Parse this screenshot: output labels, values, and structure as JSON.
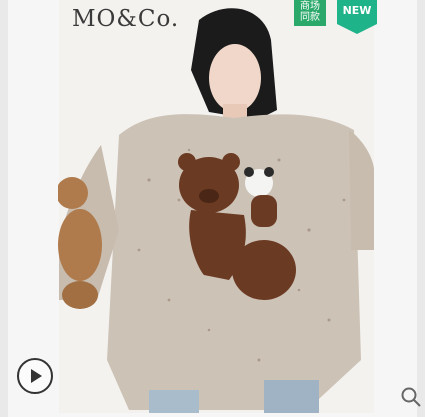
{
  "brand": "MO&Co.",
  "badges": {
    "store_label": "商场\n同款",
    "new_label": "NEW"
  },
  "colors": {
    "store_badge": "#2aa96b",
    "new_badge": "#1fb38a",
    "sweater": "#cfc4b8",
    "bear": "#6b3a22"
  },
  "icons": {
    "play": "play-icon",
    "search": "search-icon"
  }
}
